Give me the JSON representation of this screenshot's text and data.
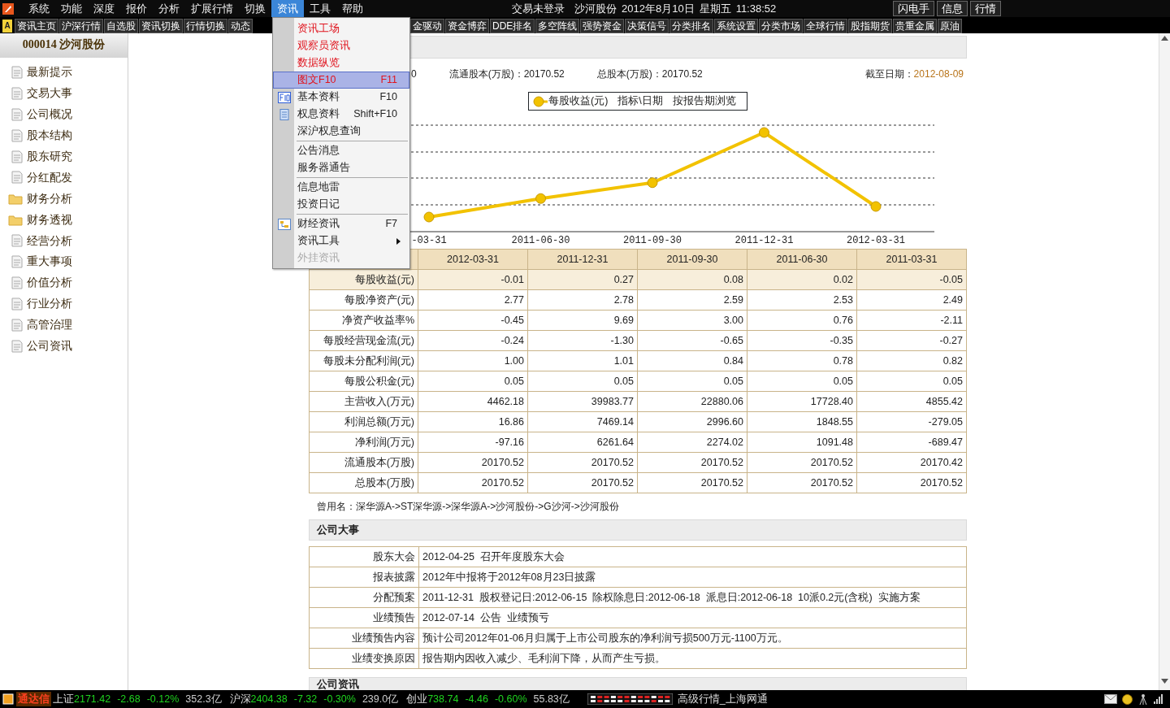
{
  "menu_bar": {
    "items": [
      {
        "label": "系统",
        "selected": false
      },
      {
        "label": "功能",
        "selected": false
      },
      {
        "label": "深度",
        "selected": false
      },
      {
        "label": "报价",
        "selected": false
      },
      {
        "label": "分析",
        "selected": false
      },
      {
        "label": "扩展行情",
        "selected": false
      },
      {
        "label": "切换",
        "selected": false
      },
      {
        "label": "资讯",
        "selected": true
      },
      {
        "label": "工具",
        "selected": false
      },
      {
        "label": "帮助",
        "selected": false
      }
    ],
    "info_texts": [
      "交易未登录",
      "沙河股份",
      "2012年8月10日",
      "星期五",
      "11:38:52"
    ],
    "buttons": [
      "闪电手",
      "信息",
      "行情"
    ]
  },
  "toolbar": {
    "badge": "A",
    "left_items": [
      "资讯主页",
      "沪深行情",
      "自选股",
      "资讯切换",
      "行情切换",
      "动态"
    ],
    "right_items": [
      "金驱动",
      "资金博弈",
      "DDE排名",
      "多空阵线",
      "强势资金",
      "决策信号",
      "分类排名",
      "系统设置",
      "分类市场",
      "全球行情",
      "股指期货",
      "贵重金属",
      "原油"
    ]
  },
  "dropdown": {
    "groups": [
      [
        {
          "label": "资讯工场",
          "kind": "featured",
          "selected": false,
          "disabled": false
        },
        {
          "label": "观察员资讯",
          "kind": "featured",
          "selected": false,
          "disabled": false
        },
        {
          "label": "数据纵览",
          "kind": "featured",
          "selected": false,
          "disabled": false
        },
        {
          "label": "图文F10",
          "shortcut": "F11",
          "kind": "featured",
          "selected": true,
          "disabled": false
        },
        {
          "label": "基本资料",
          "shortcut": "F10",
          "kind": "normal",
          "selected": false,
          "disabled": false
        },
        {
          "label": "权息资料",
          "shortcut": "Shift+F10",
          "kind": "normal",
          "selected": false,
          "disabled": false
        },
        {
          "label": "深沪权息查询",
          "kind": "normal",
          "selected": false,
          "disabled": false
        }
      ],
      [
        {
          "label": "公告消息",
          "kind": "normal",
          "selected": false,
          "disabled": false
        },
        {
          "label": "服务器通告",
          "kind": "normal",
          "selected": false,
          "disabled": false
        }
      ],
      [
        {
          "label": "信息地雷",
          "kind": "normal",
          "selected": false,
          "disabled": false
        },
        {
          "label": "投资日记",
          "kind": "normal",
          "selected": false,
          "disabled": false
        }
      ],
      [
        {
          "label": "财经资讯",
          "shortcut": "F7",
          "kind": "normal",
          "selected": false,
          "disabled": false
        },
        {
          "label": "资讯工具",
          "kind": "normal",
          "submenu": true,
          "selected": false,
          "disabled": false
        },
        {
          "label": "外挂资讯",
          "kind": "normal",
          "selected": false,
          "disabled": true
        }
      ]
    ]
  },
  "sidebar": {
    "title": "000014  沙河股份",
    "items": [
      {
        "label": "最新提示",
        "kind": "page"
      },
      {
        "label": "交易大事",
        "kind": "page"
      },
      {
        "label": "公司概况",
        "kind": "page"
      },
      {
        "label": "股本结构",
        "kind": "page"
      },
      {
        "label": "股东研究",
        "kind": "page"
      },
      {
        "label": "分红配发",
        "kind": "page"
      },
      {
        "label": "财务分析",
        "kind": "folder"
      },
      {
        "label": "财务透视",
        "kind": "folder"
      },
      {
        "label": "经营分析",
        "kind": "page"
      },
      {
        "label": "重大事项",
        "kind": "page"
      },
      {
        "label": "价值分析",
        "kind": "page"
      },
      {
        "label": "行业分析",
        "kind": "page"
      },
      {
        "label": "高管治理",
        "kind": "page"
      },
      {
        "label": "公司资讯",
        "kind": "page"
      }
    ]
  },
  "summary": {
    "texts": [
      "0",
      "流通股本(万股)：20170.52",
      "总股本(万股)：20170.52"
    ],
    "as_of_label": "截至日期：",
    "as_of_date": "2012-08-09"
  },
  "chart": {
    "legend_extras": [
      "指标\\日期",
      "按报告期浏览"
    ],
    "series_name": "每股收益(元)",
    "x_labels": [
      "-03-31",
      "2011-06-30",
      "2011-09-30",
      "2011-12-31",
      "2012-03-31"
    ]
  },
  "finance_table": {
    "columns": [
      "2012-03-31",
      "2011-12-31",
      "2011-09-30",
      "2011-06-30",
      "2011-03-31"
    ],
    "rows": [
      {
        "label": "每股收益(元)",
        "values": [
          "-0.01",
          "0.27",
          "0.08",
          "0.02",
          "-0.05"
        ],
        "selected": true
      },
      {
        "label": "每股净资产(元)",
        "values": [
          "2.77",
          "2.78",
          "2.59",
          "2.53",
          "2.49"
        ],
        "selected": false
      },
      {
        "label": "净资产收益率%",
        "values": [
          "-0.45",
          "9.69",
          "3.00",
          "0.76",
          "-2.11"
        ],
        "selected": false
      },
      {
        "label": "每股经营现金流(元)",
        "values": [
          "-0.24",
          "-1.30",
          "-0.65",
          "-0.35",
          "-0.27"
        ],
        "selected": false
      },
      {
        "label": "每股未分配利润(元)",
        "values": [
          "1.00",
          "1.01",
          "0.84",
          "0.78",
          "0.82"
        ],
        "selected": false
      },
      {
        "label": "每股公积金(元)",
        "values": [
          "0.05",
          "0.05",
          "0.05",
          "0.05",
          "0.05"
        ],
        "selected": false
      },
      {
        "label": "主营收入(万元)",
        "values": [
          "4462.18",
          "39983.77",
          "22880.06",
          "17728.40",
          "4855.42"
        ],
        "selected": false
      },
      {
        "label": "利润总额(万元)",
        "values": [
          "16.86",
          "7469.14",
          "2996.60",
          "1848.55",
          "-279.05"
        ],
        "selected": false
      },
      {
        "label": "净利润(万元)",
        "values": [
          "-97.16",
          "6261.64",
          "2274.02",
          "1091.48",
          "-689.47"
        ],
        "selected": false
      },
      {
        "label": "流通股本(万股)",
        "values": [
          "20170.52",
          "20170.52",
          "20170.52",
          "20170.52",
          "20170.42"
        ],
        "selected": false
      },
      {
        "label": "总股本(万股)",
        "values": [
          "20170.52",
          "20170.52",
          "20170.52",
          "20170.52",
          "20170.52"
        ],
        "selected": false
      }
    ]
  },
  "former_names": "曾用名：深华源A->ST深华源->深华源A->沙河股份->G沙河->沙河股份",
  "events": {
    "title": "公司大事",
    "rows": [
      {
        "label": "股东大会",
        "value": "2012-04-25  召开年度股东大会"
      },
      {
        "label": "报表披露",
        "value": "2012年中报将于2012年08月23日披露"
      },
      {
        "label": "分配预案",
        "value": "2011-12-31  股权登记日:2012-06-15  除权除息日:2012-06-18  派息日:2012-06-18  10派0.2元(含税)  实施方案"
      },
      {
        "label": "业绩预告",
        "value": "2012-07-14  公告  业绩预亏"
      },
      {
        "label": "业绩预告内容",
        "value": "预计公司2012年01-06月归属于上市公司股东的净利润亏损500万元-1100万元。"
      },
      {
        "label": "业绩变换原因",
        "value": "报告期内因收入减少、毛利润下降，从而产生亏损。"
      }
    ]
  },
  "news_section": {
    "title": "公司资讯"
  },
  "status_bar": {
    "brand": "通达信",
    "indices": [
      {
        "name": "上证",
        "value": "2171.42",
        "change": "-2.68",
        "percent": "-0.12%",
        "volume": "352.3亿",
        "down": true
      },
      {
        "name": "沪深",
        "value": "2404.38",
        "change": "-7.32",
        "percent": "-0.30%",
        "volume": "239.0亿",
        "down": true
      },
      {
        "name": "创业",
        "value": "738.74",
        "change": "-4.46",
        "percent": "-0.60%",
        "volume": "55.83亿",
        "down": true
      }
    ],
    "server": "高级行情_上海网通"
  }
}
